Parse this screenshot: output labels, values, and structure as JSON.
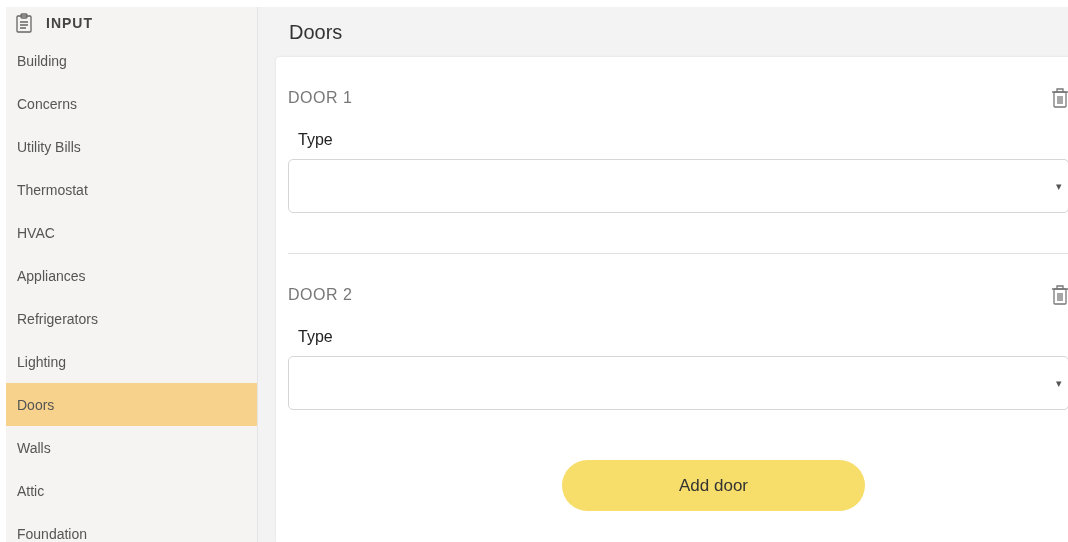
{
  "sidebar": {
    "header": "INPUT",
    "items": [
      {
        "label": "Building",
        "selected": false
      },
      {
        "label": "Concerns",
        "selected": false
      },
      {
        "label": "Utility Bills",
        "selected": false
      },
      {
        "label": "Thermostat",
        "selected": false
      },
      {
        "label": "HVAC",
        "selected": false
      },
      {
        "label": "Appliances",
        "selected": false
      },
      {
        "label": "Refrigerators",
        "selected": false
      },
      {
        "label": "Lighting",
        "selected": false
      },
      {
        "label": "Doors",
        "selected": true
      },
      {
        "label": "Walls",
        "selected": false
      },
      {
        "label": "Attic",
        "selected": false
      },
      {
        "label": "Foundation",
        "selected": false
      }
    ]
  },
  "page_title": "Doors",
  "doors": [
    {
      "title": "DOOR 1",
      "field_label": "Type",
      "dropdown_arrow": "▾"
    },
    {
      "title": "DOOR 2",
      "field_label": "Type",
      "dropdown_arrow": "▾"
    }
  ],
  "add_button": "Add door"
}
